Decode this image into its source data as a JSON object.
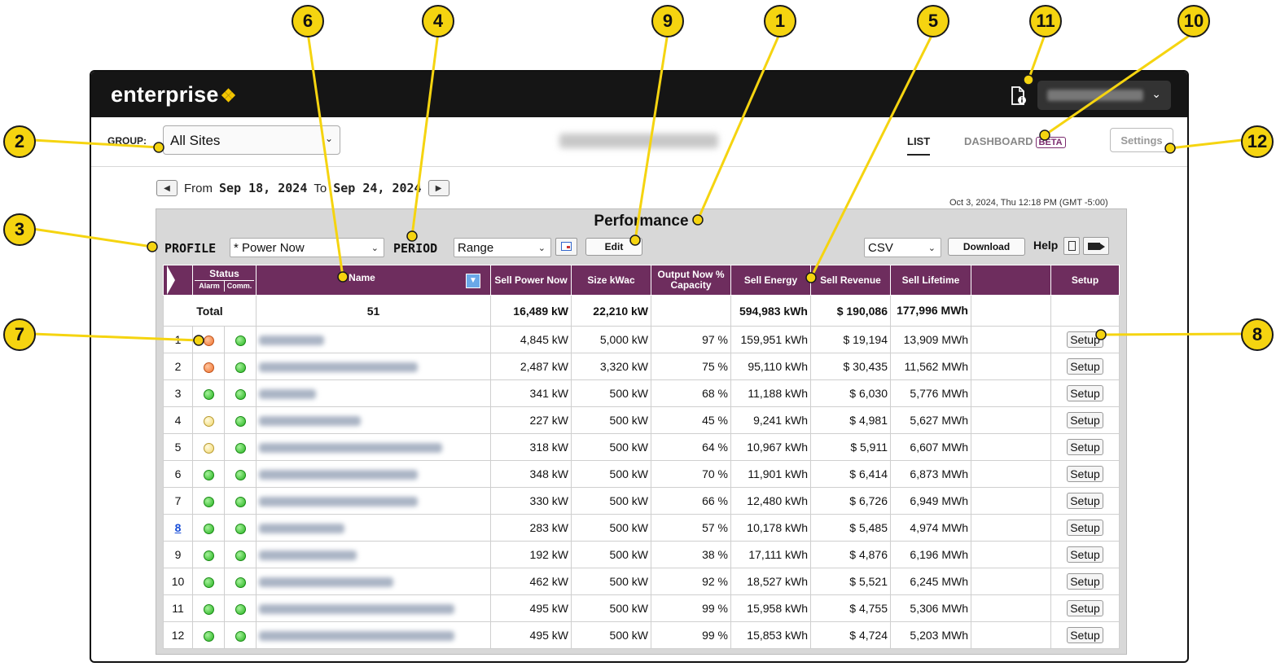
{
  "app": {
    "logo_text": "enterprise",
    "logo_mark": "❖"
  },
  "header": {
    "user_menu_value": ""
  },
  "toolbar": {
    "group_label": "GROUP:",
    "group_value": "All Sites",
    "tab_list": "LIST",
    "tab_dashboard": "DASHBOARD",
    "beta_badge": "BETA",
    "settings_label": "Settings"
  },
  "date_range": {
    "from_label": "From",
    "from_value": "Sep 18, 2024",
    "to_label": "To",
    "to_value": "Sep 24, 2024",
    "timestamp": "Oct 3, 2024, Thu 12:18 PM (GMT -5:00)"
  },
  "panel": {
    "title": "Performance",
    "profile_label": "PROFILE",
    "profile_value": "* Power Now",
    "period_label": "PERIOD",
    "period_value": "Range",
    "edit_label": "Edit",
    "export_value": "CSV",
    "download_label": "Download",
    "help_label": "Help"
  },
  "table": {
    "headers": {
      "status": "Status",
      "alarm": "Alarm",
      "comm": "Comm.",
      "name": "Name",
      "sell_power_now": "Sell Power Now",
      "size_kwac": "Size kWac",
      "output_capacity": "Output Now % Capacity",
      "sell_energy": "Sell Energy",
      "sell_revenue": "Sell Revenue",
      "sell_lifetime": "Sell Lifetime",
      "setup": "Setup"
    },
    "total": {
      "label": "Total",
      "name": "51",
      "sell_power_now": "16,489 kW",
      "size_kwac": "22,210 kW",
      "sell_energy": "594,983 kWh",
      "sell_revenue": "$ 190,086",
      "sell_lifetime": "177,996 MWh"
    },
    "rows": [
      {
        "num": "1",
        "alarm": "orange",
        "comm": "green",
        "power": "4,845 kW",
        "size": "5,000 kW",
        "cap": "97 %",
        "energy": "159,951 kWh",
        "revenue": "$ 19,194",
        "lifetime": "13,909 MWh",
        "setup": "Setup"
      },
      {
        "num": "2",
        "alarm": "orange",
        "comm": "green",
        "power": "2,487 kW",
        "size": "3,320 kW",
        "cap": "75 %",
        "energy": "95,110 kWh",
        "revenue": "$ 30,435",
        "lifetime": "11,562 MWh",
        "setup": "Setup"
      },
      {
        "num": "3",
        "alarm": "green",
        "comm": "green",
        "power": "341 kW",
        "size": "500 kW",
        "cap": "68 %",
        "energy": "11,188 kWh",
        "revenue": "$ 6,030",
        "lifetime": "5,776 MWh",
        "setup": "Setup"
      },
      {
        "num": "4",
        "alarm": "yellow",
        "comm": "green",
        "power": "227 kW",
        "size": "500 kW",
        "cap": "45 %",
        "energy": "9,241 kWh",
        "revenue": "$ 4,981",
        "lifetime": "5,627 MWh",
        "setup": "Setup"
      },
      {
        "num": "5",
        "alarm": "yellow",
        "comm": "green",
        "power": "318 kW",
        "size": "500 kW",
        "cap": "64 %",
        "energy": "10,967 kWh",
        "revenue": "$ 5,911",
        "lifetime": "6,607 MWh",
        "setup": "Setup"
      },
      {
        "num": "6",
        "alarm": "green",
        "comm": "green",
        "power": "348 kW",
        "size": "500 kW",
        "cap": "70 %",
        "energy": "11,901 kWh",
        "revenue": "$ 6,414",
        "lifetime": "6,873 MWh",
        "setup": "Setup"
      },
      {
        "num": "7",
        "alarm": "green",
        "comm": "green",
        "power": "330 kW",
        "size": "500 kW",
        "cap": "66 %",
        "energy": "12,480 kWh",
        "revenue": "$ 6,726",
        "lifetime": "6,949 MWh",
        "setup": "Setup"
      },
      {
        "num": "8",
        "alarm": "green",
        "comm": "green",
        "power": "283 kW",
        "size": "500 kW",
        "cap": "57 %",
        "energy": "10,178 kWh",
        "revenue": "$ 5,485",
        "lifetime": "4,974 MWh",
        "setup": "Setup"
      },
      {
        "num": "9",
        "alarm": "green",
        "comm": "green",
        "power": "192 kW",
        "size": "500 kW",
        "cap": "38 %",
        "energy": "17,111 kWh",
        "revenue": "$ 4,876",
        "lifetime": "6,196 MWh",
        "setup": "Setup"
      },
      {
        "num": "10",
        "alarm": "green",
        "comm": "green",
        "power": "462 kW",
        "size": "500 kW",
        "cap": "92 %",
        "energy": "18,527 kWh",
        "revenue": "$ 5,521",
        "lifetime": "6,245 MWh",
        "setup": "Setup"
      },
      {
        "num": "11",
        "alarm": "green",
        "comm": "green",
        "power": "495 kW",
        "size": "500 kW",
        "cap": "99 %",
        "energy": "15,958 kWh",
        "revenue": "$ 4,755",
        "lifetime": "5,306 MWh",
        "setup": "Setup"
      },
      {
        "num": "12",
        "alarm": "green",
        "comm": "green",
        "power": "495 kW",
        "size": "500 kW",
        "cap": "99 %",
        "energy": "15,853 kWh",
        "revenue": "$ 4,724",
        "lifetime": "5,203 MWh",
        "setup": "Setup"
      }
    ]
  },
  "callouts": [
    "1",
    "2",
    "3",
    "4",
    "5",
    "6",
    "7",
    "8",
    "9",
    "10",
    "11",
    "12"
  ],
  "colors": {
    "header_bar": "#151515",
    "table_header": "#6e2d5e",
    "callout": "#f5d410",
    "logo_accent": "#f2c400",
    "beta": "#7b2b6e",
    "status_green": "#25b31e",
    "status_orange": "#f0722d",
    "status_yellow": "#f1d66a"
  },
  "icons": {
    "prev": "triangle-left",
    "next": "triangle-right",
    "calendar": "calendar-icon",
    "report": "document-info-icon",
    "help_doc": "document-icon",
    "help_video": "video-camera-icon",
    "sort": "chevron-down-icon"
  }
}
